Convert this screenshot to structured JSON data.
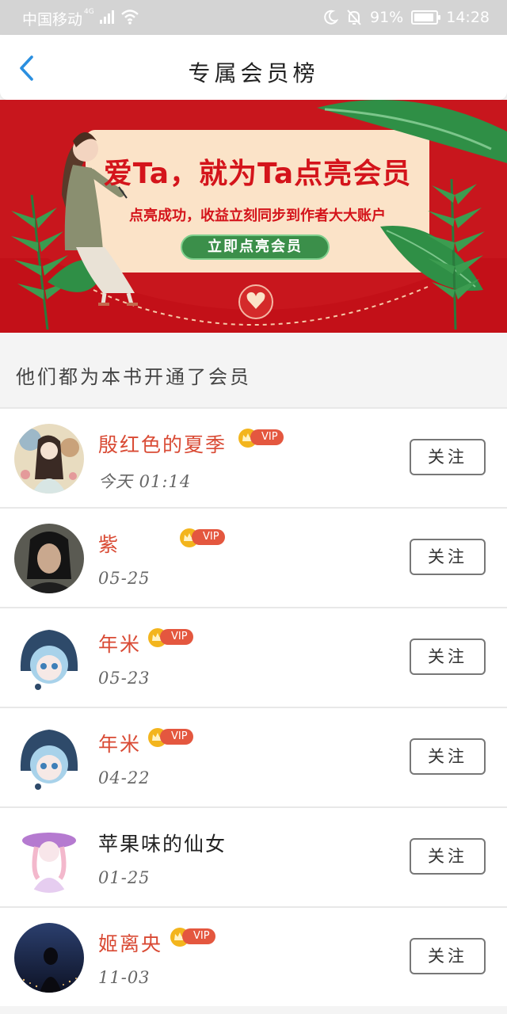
{
  "status_bar": {
    "carrier": "中国移动",
    "network": "4G",
    "battery": "91%",
    "battery_level": 0.91,
    "time": "14:28"
  },
  "header": {
    "title": "专属会员榜"
  },
  "banner": {
    "headline": "爱Ta，就为Ta点亮会员",
    "subtitle": "点亮成功，收益立刻同步到作者大大账户",
    "button_label": "立即点亮会员"
  },
  "section": {
    "title": "他们都为本书开通了会员"
  },
  "vip_label": "VIP",
  "follow_label": "关注",
  "members": [
    {
      "name": "殷红色的夏季",
      "time": "今天 01:14",
      "vip": true,
      "avatar": "avatar-anime-girl-flowers"
    },
    {
      "name": "紫",
      "time": "05-25",
      "vip": true,
      "avatar": "avatar-photo-girl"
    },
    {
      "name": "年米",
      "time": "05-23",
      "vip": true,
      "avatar": "avatar-penguin-hood-girl"
    },
    {
      "name": "年米",
      "time": "04-22",
      "vip": true,
      "avatar": "avatar-penguin-hood-girl"
    },
    {
      "name": "苹果味的仙女",
      "time": "01-25",
      "vip": false,
      "avatar": "avatar-purple-hat-girl"
    },
    {
      "name": "姬离央",
      "time": "11-03",
      "vip": true,
      "avatar": "avatar-night-city-girl"
    }
  ],
  "colors": {
    "vip_name": "#d94a34",
    "banner_red": "#d4141b",
    "banner_button": "#3b8f4a",
    "back_arrow": "#2a8fe0"
  }
}
